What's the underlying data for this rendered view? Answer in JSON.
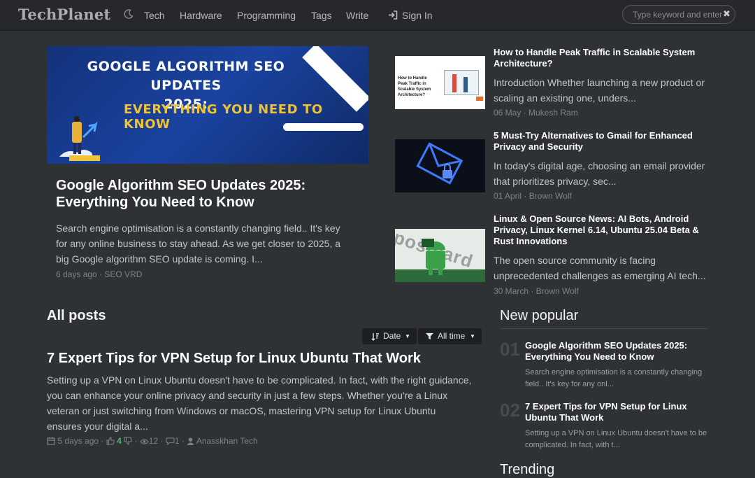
{
  "navbar": {
    "brand": "TechPlanet",
    "items": [
      "Tech",
      "Hardware",
      "Programming",
      "Tags",
      "Write"
    ],
    "sign_in": "Sign In",
    "search_placeholder": "Type keyword and enter..."
  },
  "hero": {
    "image_text_line1": "GOOGLE ALGORITHM SEO UPDATES",
    "image_text_line2": "2025:",
    "image_text_line3": "EVERYTHING YOU NEED TO KNOW",
    "title": "Google Algorithm SEO Updates 2025: Everything You Need to Know",
    "excerpt": "Search engine optimisation is a constantly changing field.. It's key for any online business to stay ahead. As we get closer to 2025, a big Google algorithm SEO update is coming. I...",
    "meta": "6 days ago · SEO VRD"
  },
  "side_articles": [
    {
      "title": "How to Handle Peak Traffic in Scalable System Architecture?",
      "excerpt": "Introduction Whether launching a new product or scaling an existing one, unders...",
      "meta": "06 May · Mukesh Ram",
      "thumb_text": "How to Handle Peak Traffic in Scalable System Architecture?"
    },
    {
      "title": "5 Must-Try Alternatives to Gmail for Enhanced Privacy and Security",
      "excerpt": "In today's digital age, choosing an email provider that prioritizes privacy, sec...",
      "meta": "01 April · Brown Wolf"
    },
    {
      "title": "Linux & Open Source News: AI Bots, Android Privacy, Linux Kernel 6.14, Ubuntu 25.04 Beta & Rust Innovations",
      "excerpt": "The open source community is facing unprecedented challenges as emerging AI tech...",
      "meta": "30 March · Brown Wolf",
      "thumb_text": "postcard"
    }
  ],
  "all_posts": {
    "heading": "All posts",
    "sort_label": "Date",
    "filter_label": "All time",
    "post": {
      "title": "7 Expert Tips for VPN Setup for Linux Ubuntu That Work",
      "excerpt": "Setting up a VPN on Linux Ubuntu doesn't have to be complicated. In fact, with the right guidance, you can enhance your online privacy and security in just a few steps. Whether you're a Linux veteran or just switching from Windows or macOS, mastering VPN setup for Linux Ubuntu ensures your digital a...",
      "date": "5 days ago",
      "likes": "4",
      "views": "12",
      "comments": "1",
      "author": "Anasskhan Tech"
    }
  },
  "new_popular": {
    "heading": "New popular",
    "items": [
      {
        "num": "01",
        "title": "Google Algorithm SEO Updates 2025: Everything You Need to Know",
        "excerpt": "Search engine optimisation is a constantly changing field.. It's key for any onl..."
      },
      {
        "num": "02",
        "title": "7 Expert Tips for VPN Setup for Linux Ubuntu That Work",
        "excerpt": "Setting up a VPN on Linux Ubuntu doesn't have to be complicated. In fact, with t..."
      }
    ]
  },
  "trending": {
    "heading": "Trending"
  }
}
